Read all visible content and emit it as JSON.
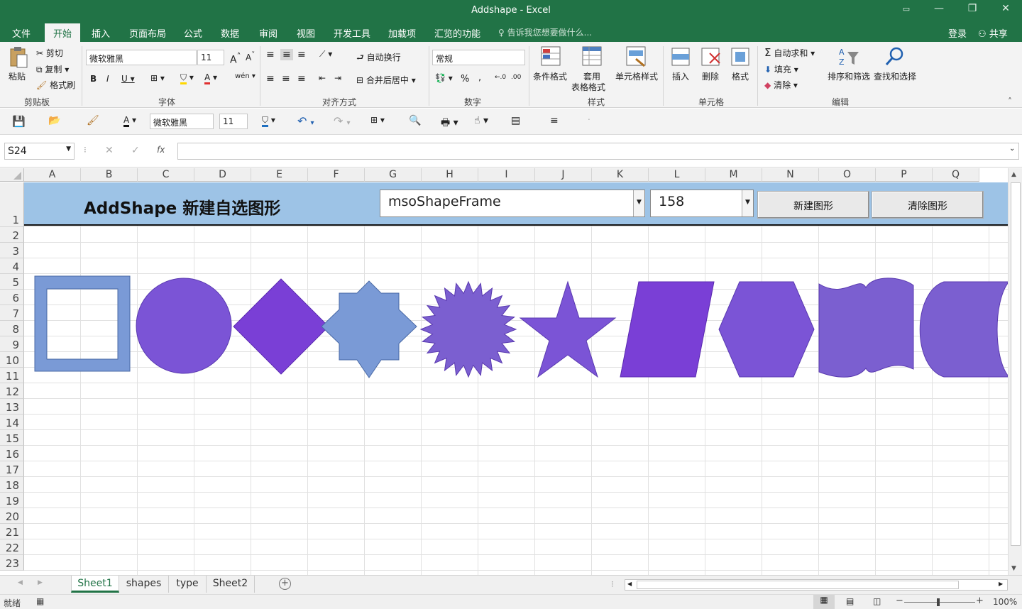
{
  "window": {
    "title": "Addshape - Excel"
  },
  "ribbon_tabs": [
    "文件",
    "开始",
    "插入",
    "页面布局",
    "公式",
    "数据",
    "审阅",
    "视图",
    "开发工具",
    "加载项",
    "汇览的功能"
  ],
  "tell_me": "告诉我您想要做什么...",
  "account": {
    "login": "登录",
    "share": "共享"
  },
  "clipboard": {
    "paste": "粘贴",
    "cut": "剪切",
    "copy": "复制",
    "format_painter": "格式刷",
    "label": "剪贴板"
  },
  "font_group": {
    "font_name": "微软雅黑",
    "font_size": "11",
    "label": "字体"
  },
  "align_group": {
    "wrap": "自动换行",
    "merge": "合并后居中",
    "label": "对齐方式"
  },
  "number_group": {
    "format": "常规",
    "label": "数字"
  },
  "styles_group": {
    "cond": "条件格式",
    "table1": "套用",
    "table2": "表格格式",
    "cell_styles": "单元格样式",
    "label": "样式"
  },
  "cells_group": {
    "insert": "插入",
    "delete": "删除",
    "format": "格式",
    "label": "单元格"
  },
  "edit_group": {
    "autosum": "自动求和",
    "fill": "填充",
    "clear": "清除",
    "sort": "排序和筛选",
    "find": "查找和选择",
    "label": "编辑"
  },
  "qat": {
    "font_name": "微软雅黑",
    "font_size": "11"
  },
  "formula_bar": {
    "name_box": "S24",
    "fx": "fx",
    "formula": ""
  },
  "columns": [
    "A",
    "B",
    "C",
    "D",
    "E",
    "F",
    "G",
    "H",
    "I",
    "J",
    "K",
    "L",
    "M",
    "N",
    "O",
    "P",
    "Q"
  ],
  "rows": [
    "1",
    "2",
    "3",
    "4",
    "5",
    "6",
    "7",
    "8",
    "9",
    "10",
    "11",
    "12",
    "13",
    "14",
    "15",
    "16",
    "17",
    "18",
    "19",
    "20",
    "21",
    "22",
    "23"
  ],
  "banner": {
    "title": "AddShape 新建自选图形",
    "shape_select": "msoShapeFrame",
    "number_select": "158",
    "new_button": "新建图形",
    "clear_button": "清除图形",
    "bg_color": "#9dc3e6"
  },
  "shapes": [
    {
      "name": "frame",
      "color": "#7a9ad6"
    },
    {
      "name": "oval",
      "color": "#7b54d6"
    },
    {
      "name": "diamond",
      "color": "#7a3fd6"
    },
    {
      "name": "12-point-star",
      "color": "#7a9ad6"
    },
    {
      "name": "24-point-star",
      "color": "#7b5fd0"
    },
    {
      "name": "5-point-star",
      "color": "#7b54d6"
    },
    {
      "name": "parallelogram",
      "color": "#7a3fd6"
    },
    {
      "name": "hexagon",
      "color": "#7b54d6"
    },
    {
      "name": "wave",
      "color": "#7b5fd0"
    },
    {
      "name": "flowchart-stored-data",
      "color": "#7b5fd0"
    }
  ],
  "sheet_tabs": [
    "Sheet1",
    "shapes",
    "type",
    "Sheet2"
  ],
  "active_sheet": "Sheet1",
  "status": {
    "ready": "就绪",
    "zoom": "100%"
  }
}
